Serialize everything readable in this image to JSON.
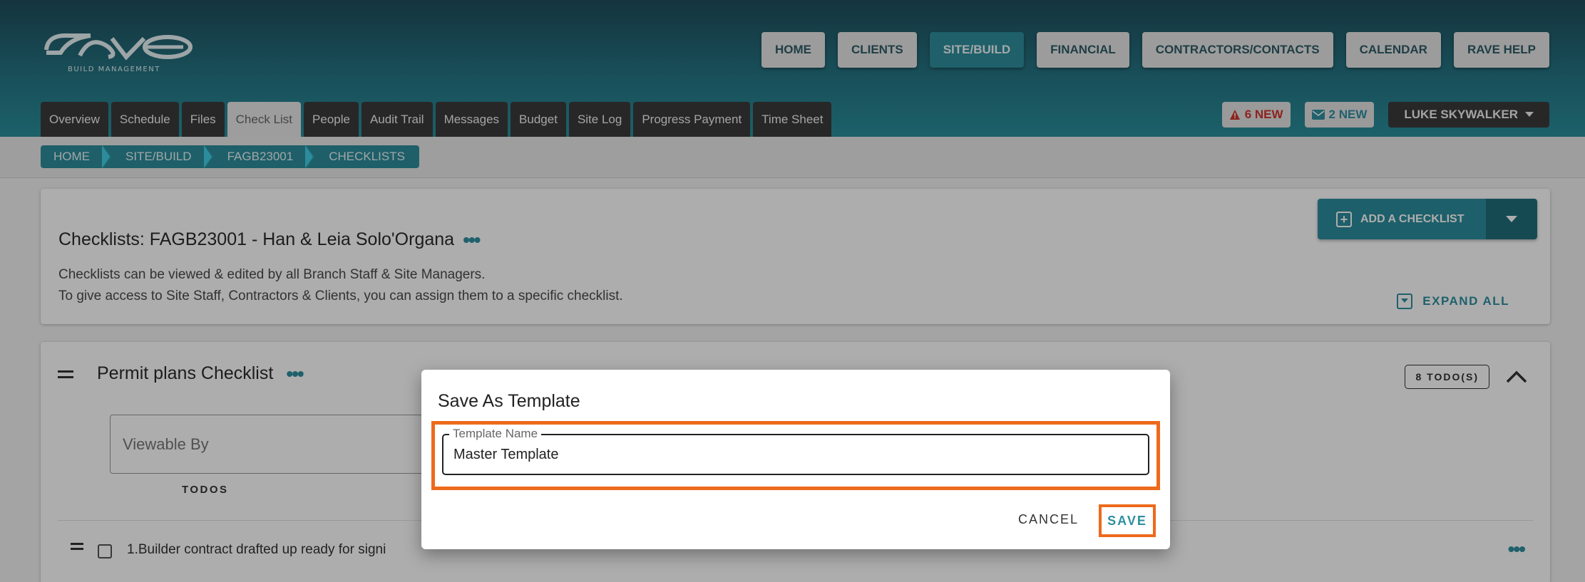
{
  "header": {
    "logo_text": "rave",
    "logo_subtitle": "BUILD MANAGEMENT",
    "nav": [
      {
        "label": "HOME"
      },
      {
        "label": "CLIENTS"
      },
      {
        "label": "SITE/BUILD",
        "active": true
      },
      {
        "label": "FINANCIAL"
      },
      {
        "label": "CONTRACTORS/CONTACTS"
      },
      {
        "label": "CALENDAR"
      },
      {
        "label": "RAVE HELP"
      }
    ],
    "tabs": [
      "Overview",
      "Schedule",
      "Files",
      "Check List",
      "People",
      "Audit Trail",
      "Messages",
      "Budget",
      "Site Log",
      "Progress Payment",
      "Time Sheet"
    ],
    "active_tab": "Check List",
    "alerts_badge": "6 NEW",
    "messages_badge": "2 NEW",
    "user_name": "LUKE SKYWALKER"
  },
  "breadcrumb": [
    "HOME",
    "SITE/BUILD",
    "FAGB23001",
    "CHECKLISTS"
  ],
  "checklists_card": {
    "title": "Checklists: FAGB23001 - Han & Leia Solo'Organa",
    "desc_line1": "Checklists can be viewed & edited by all Branch Staff & Site Managers.",
    "desc_line2": "To give access to Site Staff, Contractors & Clients, you can assign them to a specific checklist.",
    "add_button": "ADD A CHECKLIST",
    "expand_all": "EXPAND ALL"
  },
  "checklist": {
    "title": "Permit plans Checklist",
    "todo_count": "8 TODO(S)",
    "viewable_placeholder": "Viewable By",
    "todos_header": "TODOS",
    "first_item": "1.Builder contract drafted up ready for signi"
  },
  "dialog": {
    "title": "Save As Template",
    "field_label": "Template Name",
    "field_value": "Master Template",
    "cancel": "CANCEL",
    "save": "SAVE"
  },
  "colors": {
    "accent": "#2f8fa0",
    "highlight": "#ed6a1c",
    "alert": "#d0342c"
  }
}
